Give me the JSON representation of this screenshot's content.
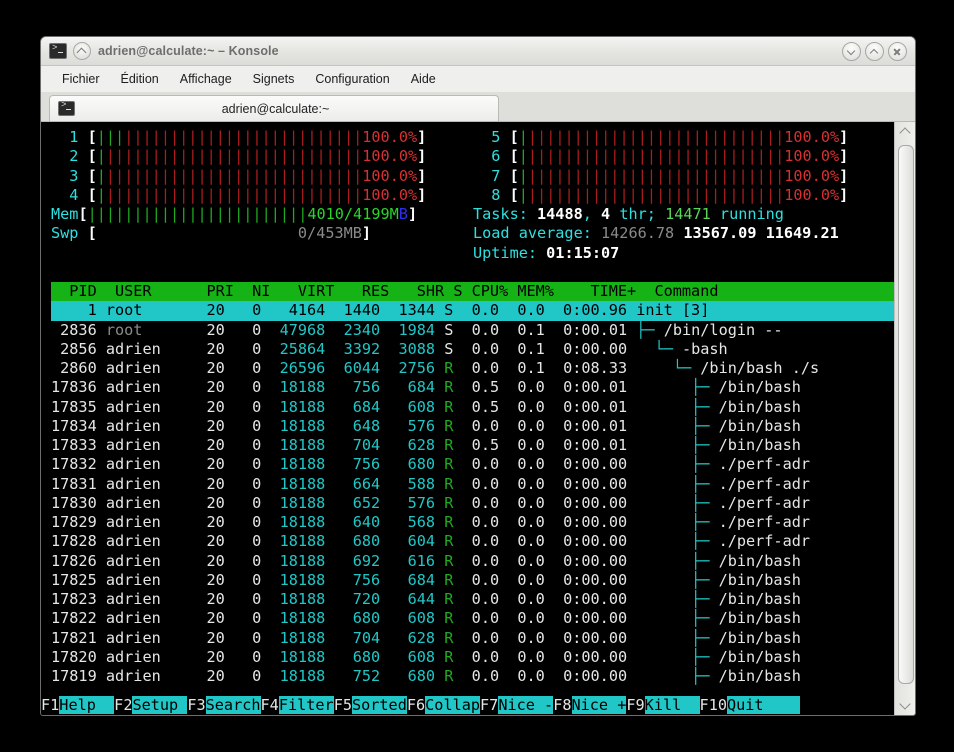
{
  "window": {
    "title": "adrien@calculate:~ – Konsole",
    "icons": {
      "app": "terminal-icon",
      "pin": "shade-icon"
    },
    "buttons": [
      {
        "name": "minimize-button",
        "icon": "chevron-down-icon"
      },
      {
        "name": "maximize-button",
        "icon": "chevron-up-icon"
      },
      {
        "name": "close-button",
        "icon": "close-x-icon"
      }
    ]
  },
  "menubar": {
    "items": [
      {
        "label": "Fichier",
        "name": "menu-fichier"
      },
      {
        "label": "Édition",
        "name": "menu-edition"
      },
      {
        "label": "Affichage",
        "name": "menu-affichage"
      },
      {
        "label": "Signets",
        "name": "menu-signets"
      },
      {
        "label": "Configuration",
        "name": "menu-configuration"
      },
      {
        "label": "Aide",
        "name": "menu-aide"
      }
    ]
  },
  "tabs": [
    {
      "label": "adrien@calculate:~",
      "icon": "terminal-icon",
      "active": true
    }
  ],
  "htop": {
    "cpus_left": [
      {
        "id": "1",
        "pct": "100.0%",
        "green_cells": 3,
        "red_cells": 26
      },
      {
        "id": "2",
        "pct": "100.0%",
        "green_cells": 1,
        "red_cells": 28
      },
      {
        "id": "3",
        "pct": "100.0%",
        "green_cells": 1,
        "red_cells": 28
      },
      {
        "id": "4",
        "pct": "100.0%",
        "green_cells": 1,
        "red_cells": 28
      }
    ],
    "cpus_right": [
      {
        "id": "5",
        "pct": "100.0%",
        "green_cells": 1,
        "red_cells": 28
      },
      {
        "id": "6",
        "pct": "100.0%",
        "green_cells": 1,
        "red_cells": 28
      },
      {
        "id": "7",
        "pct": "100.0%",
        "green_cells": 1,
        "red_cells": 28
      },
      {
        "id": "8",
        "pct": "100.0%",
        "green_cells": 1,
        "red_cells": 28
      }
    ],
    "mem": {
      "label": "Mem",
      "used": "4010",
      "total": "4199",
      "unit_m": "M",
      "unit_b": "B",
      "text": "4010/4199MB",
      "green_cells": 24
    },
    "swp": {
      "label": "Swp",
      "used": "0",
      "total": "453",
      "unit": "MB",
      "text": "0/453MB",
      "cells": 0
    },
    "tasks": {
      "label": "Tasks:",
      "total": "14488",
      "thr_count": "4",
      "thr_word": "thr;",
      "running": "14471",
      "running_word": "running"
    },
    "load": {
      "label": "Load average:",
      "one": "14266.78",
      "five": "13567.09",
      "fifteen": "11649.21"
    },
    "uptime": {
      "label": "Uptime:",
      "value": "01:15:07"
    },
    "columns": [
      "PID",
      "USER",
      "PRI",
      "NI",
      "VIRT",
      "RES",
      "SHR",
      "S",
      "CPU%",
      "MEM%",
      "TIME+",
      "Command"
    ],
    "header_line": "  PID USER      PRI  NI  VIRT   RES   SHR S CPU% MEM%   TIME+  Command",
    "rows": [
      {
        "pid": "1",
        "user": "root",
        "user_dim": false,
        "pri": "20",
        "ni": "0",
        "virt": "4164",
        "res": "1440",
        "shr": "1344",
        "s": "S",
        "cpu": "0.0",
        "mem": "0.0",
        "time": "0:00.96",
        "cmd": "init [3]",
        "tree": "",
        "selected": true
      },
      {
        "pid": "2836",
        "user": "root",
        "user_dim": true,
        "pri": "20",
        "ni": "0",
        "virt": "47968",
        "res": "2340",
        "shr": "1984",
        "s": "S",
        "cpu": "0.0",
        "mem": "0.1",
        "time": "0:00.01",
        "cmd": "/bin/login --",
        "tree": "t1",
        "selected": false
      },
      {
        "pid": "2856",
        "user": "adrien",
        "user_dim": false,
        "pri": "20",
        "ni": "0",
        "virt": "25864",
        "res": "3392",
        "shr": "3088",
        "s": "S",
        "cpu": "0.0",
        "mem": "0.1",
        "time": "0:00.00",
        "cmd": "-bash",
        "tree": "t2",
        "selected": false
      },
      {
        "pid": "2860",
        "user": "adrien",
        "user_dim": false,
        "pri": "20",
        "ni": "0",
        "virt": "26596",
        "res": "6044",
        "shr": "2756",
        "s": "R",
        "cpu": "0.0",
        "mem": "0.1",
        "time": "0:08.33",
        "cmd": "/bin/bash ./s",
        "tree": "t3",
        "selected": false
      },
      {
        "pid": "17836",
        "user": "adrien",
        "user_dim": false,
        "pri": "20",
        "ni": "0",
        "virt": "18188",
        "res": "756",
        "shr": "684",
        "s": "R",
        "cpu": "0.5",
        "mem": "0.0",
        "time": "0:00.01",
        "cmd": "/bin/bash",
        "tree": "t4",
        "selected": false
      },
      {
        "pid": "17835",
        "user": "adrien",
        "user_dim": false,
        "pri": "20",
        "ni": "0",
        "virt": "18188",
        "res": "684",
        "shr": "608",
        "s": "R",
        "cpu": "0.5",
        "mem": "0.0",
        "time": "0:00.01",
        "cmd": "/bin/bash",
        "tree": "t4",
        "selected": false
      },
      {
        "pid": "17834",
        "user": "adrien",
        "user_dim": false,
        "pri": "20",
        "ni": "0",
        "virt": "18188",
        "res": "648",
        "shr": "576",
        "s": "R",
        "cpu": "0.0",
        "mem": "0.0",
        "time": "0:00.01",
        "cmd": "/bin/bash",
        "tree": "t4",
        "selected": false
      },
      {
        "pid": "17833",
        "user": "adrien",
        "user_dim": false,
        "pri": "20",
        "ni": "0",
        "virt": "18188",
        "res": "704",
        "shr": "628",
        "s": "R",
        "cpu": "0.5",
        "mem": "0.0",
        "time": "0:00.01",
        "cmd": "/bin/bash",
        "tree": "t4",
        "selected": false
      },
      {
        "pid": "17832",
        "user": "adrien",
        "user_dim": false,
        "pri": "20",
        "ni": "0",
        "virt": "18188",
        "res": "756",
        "shr": "680",
        "s": "R",
        "cpu": "0.0",
        "mem": "0.0",
        "time": "0:00.00",
        "cmd": "./perf-adr",
        "tree": "t4",
        "selected": false
      },
      {
        "pid": "17831",
        "user": "adrien",
        "user_dim": false,
        "pri": "20",
        "ni": "0",
        "virt": "18188",
        "res": "664",
        "shr": "588",
        "s": "R",
        "cpu": "0.0",
        "mem": "0.0",
        "time": "0:00.00",
        "cmd": "./perf-adr",
        "tree": "t4",
        "selected": false
      },
      {
        "pid": "17830",
        "user": "adrien",
        "user_dim": false,
        "pri": "20",
        "ni": "0",
        "virt": "18188",
        "res": "652",
        "shr": "576",
        "s": "R",
        "cpu": "0.0",
        "mem": "0.0",
        "time": "0:00.00",
        "cmd": "./perf-adr",
        "tree": "t4",
        "selected": false
      },
      {
        "pid": "17829",
        "user": "adrien",
        "user_dim": false,
        "pri": "20",
        "ni": "0",
        "virt": "18188",
        "res": "640",
        "shr": "568",
        "s": "R",
        "cpu": "0.0",
        "mem": "0.0",
        "time": "0:00.00",
        "cmd": "./perf-adr",
        "tree": "t4",
        "selected": false
      },
      {
        "pid": "17828",
        "user": "adrien",
        "user_dim": false,
        "pri": "20",
        "ni": "0",
        "virt": "18188",
        "res": "680",
        "shr": "604",
        "s": "R",
        "cpu": "0.0",
        "mem": "0.0",
        "time": "0:00.00",
        "cmd": "./perf-adr",
        "tree": "t4",
        "selected": false
      },
      {
        "pid": "17826",
        "user": "adrien",
        "user_dim": false,
        "pri": "20",
        "ni": "0",
        "virt": "18188",
        "res": "692",
        "shr": "616",
        "s": "R",
        "cpu": "0.0",
        "mem": "0.0",
        "time": "0:00.00",
        "cmd": "/bin/bash",
        "tree": "t4",
        "selected": false
      },
      {
        "pid": "17825",
        "user": "adrien",
        "user_dim": false,
        "pri": "20",
        "ni": "0",
        "virt": "18188",
        "res": "756",
        "shr": "684",
        "s": "R",
        "cpu": "0.0",
        "mem": "0.0",
        "time": "0:00.00",
        "cmd": "/bin/bash",
        "tree": "t4",
        "selected": false
      },
      {
        "pid": "17823",
        "user": "adrien",
        "user_dim": false,
        "pri": "20",
        "ni": "0",
        "virt": "18188",
        "res": "720",
        "shr": "644",
        "s": "R",
        "cpu": "0.0",
        "mem": "0.0",
        "time": "0:00.00",
        "cmd": "/bin/bash",
        "tree": "t4",
        "selected": false
      },
      {
        "pid": "17822",
        "user": "adrien",
        "user_dim": false,
        "pri": "20",
        "ni": "0",
        "virt": "18188",
        "res": "680",
        "shr": "608",
        "s": "R",
        "cpu": "0.0",
        "mem": "0.0",
        "time": "0:00.00",
        "cmd": "/bin/bash",
        "tree": "t4",
        "selected": false
      },
      {
        "pid": "17821",
        "user": "adrien",
        "user_dim": false,
        "pri": "20",
        "ni": "0",
        "virt": "18188",
        "res": "704",
        "shr": "628",
        "s": "R",
        "cpu": "0.0",
        "mem": "0.0",
        "time": "0:00.00",
        "cmd": "/bin/bash",
        "tree": "t4",
        "selected": false
      },
      {
        "pid": "17820",
        "user": "adrien",
        "user_dim": false,
        "pri": "20",
        "ni": "0",
        "virt": "18188",
        "res": "680",
        "shr": "608",
        "s": "R",
        "cpu": "0.0",
        "mem": "0.0",
        "time": "0:00.00",
        "cmd": "/bin/bash",
        "tree": "t4",
        "selected": false
      },
      {
        "pid": "17819",
        "user": "adrien",
        "user_dim": false,
        "pri": "20",
        "ni": "0",
        "virt": "18188",
        "res": "752",
        "shr": "680",
        "s": "R",
        "cpu": "0.0",
        "mem": "0.0",
        "time": "0:00.00",
        "cmd": "/bin/bash",
        "tree": "t4",
        "selected": false
      }
    ],
    "function_keys": [
      {
        "key": "F1",
        "label": "Help  "
      },
      {
        "key": "F2",
        "label": "Setup "
      },
      {
        "key": "F3",
        "label": "Search"
      },
      {
        "key": "F4",
        "label": "Filter"
      },
      {
        "key": "F5",
        "label": "Sorted"
      },
      {
        "key": "F6",
        "label": "Collap"
      },
      {
        "key": "F7",
        "label": "Nice -"
      },
      {
        "key": "F8",
        "label": "Nice +"
      },
      {
        "key": "F9",
        "label": "Kill  "
      },
      {
        "key": "F10",
        "label": "Quit  "
      }
    ]
  },
  "colors": {
    "cpu_low": "#1faa1f",
    "cpu_high": "#ab1d1d",
    "meter_text": "#d83030",
    "accent_cyan": "#21c7c7",
    "header_green": "#16b316",
    "desktop": "#000000"
  }
}
